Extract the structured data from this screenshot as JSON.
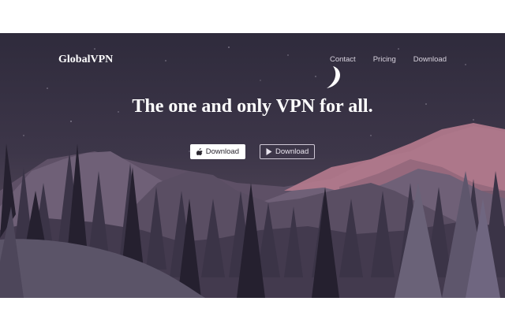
{
  "header": {
    "brand": "GlobalVPN",
    "nav": [
      {
        "label": "Contact"
      },
      {
        "label": "Pricing"
      },
      {
        "label": "Download"
      }
    ]
  },
  "hero": {
    "headline": "The one and only VPN for all.",
    "buttons": [
      {
        "label": "Download",
        "icon": "apple-icon"
      },
      {
        "label": "Download",
        "icon": "play-icon"
      }
    ]
  },
  "colors": {
    "sky_top": "#2f2b3c",
    "sky_bottom": "#6a5562",
    "accent_peak": "#c47f93"
  }
}
